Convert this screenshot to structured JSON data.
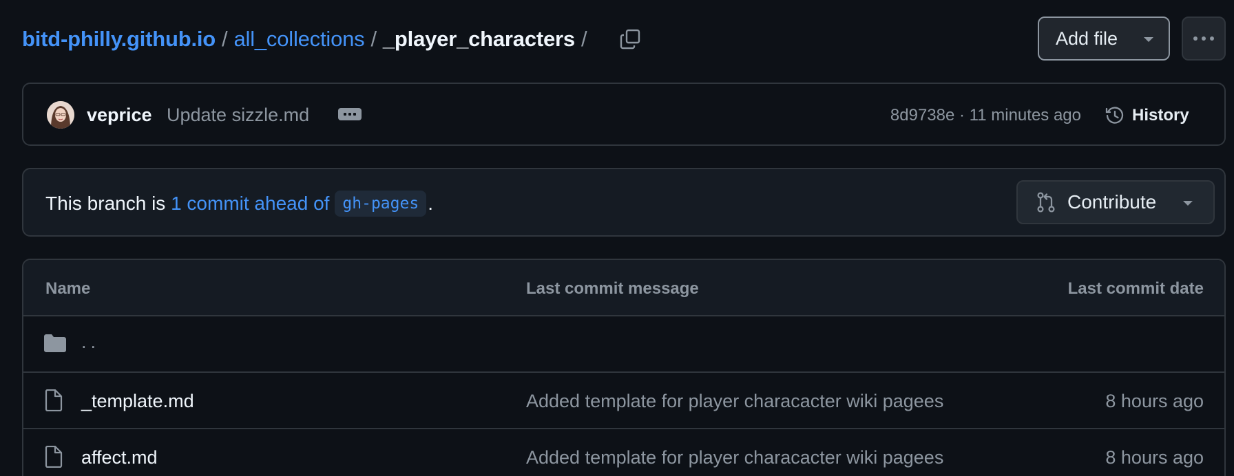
{
  "breadcrumb": {
    "repo": "bitd-philly.github.io",
    "folder": "all_collections",
    "current": "_player_characters",
    "separator": "/"
  },
  "toolbar": {
    "add_file_label": "Add file"
  },
  "latest_commit": {
    "author": "veprice",
    "message": "Update sizzle.md",
    "sha": "8d9738e",
    "dot": " · ",
    "time": "11 minutes ago",
    "history_label": "History"
  },
  "branch_banner": {
    "prefix": "This branch is ",
    "ahead_link": "1 commit ahead of",
    "base_branch": "gh-pages",
    "suffix": ".",
    "contribute_label": "Contribute"
  },
  "table": {
    "headers": {
      "name": "Name",
      "message": "Last commit message",
      "date": "Last commit date"
    },
    "parent_dir": "..",
    "rows": [
      {
        "name": "_template.md",
        "message": "Added template for player characacter wiki pagees",
        "date": "8 hours ago"
      },
      {
        "name": "affect.md",
        "message": "Added template for player characacter wiki pagees",
        "date": "8 hours ago"
      }
    ]
  },
  "colors": {
    "background": "#0d1117",
    "link": "#4493f8",
    "border": "#30363d",
    "muted": "#8d96a0"
  }
}
